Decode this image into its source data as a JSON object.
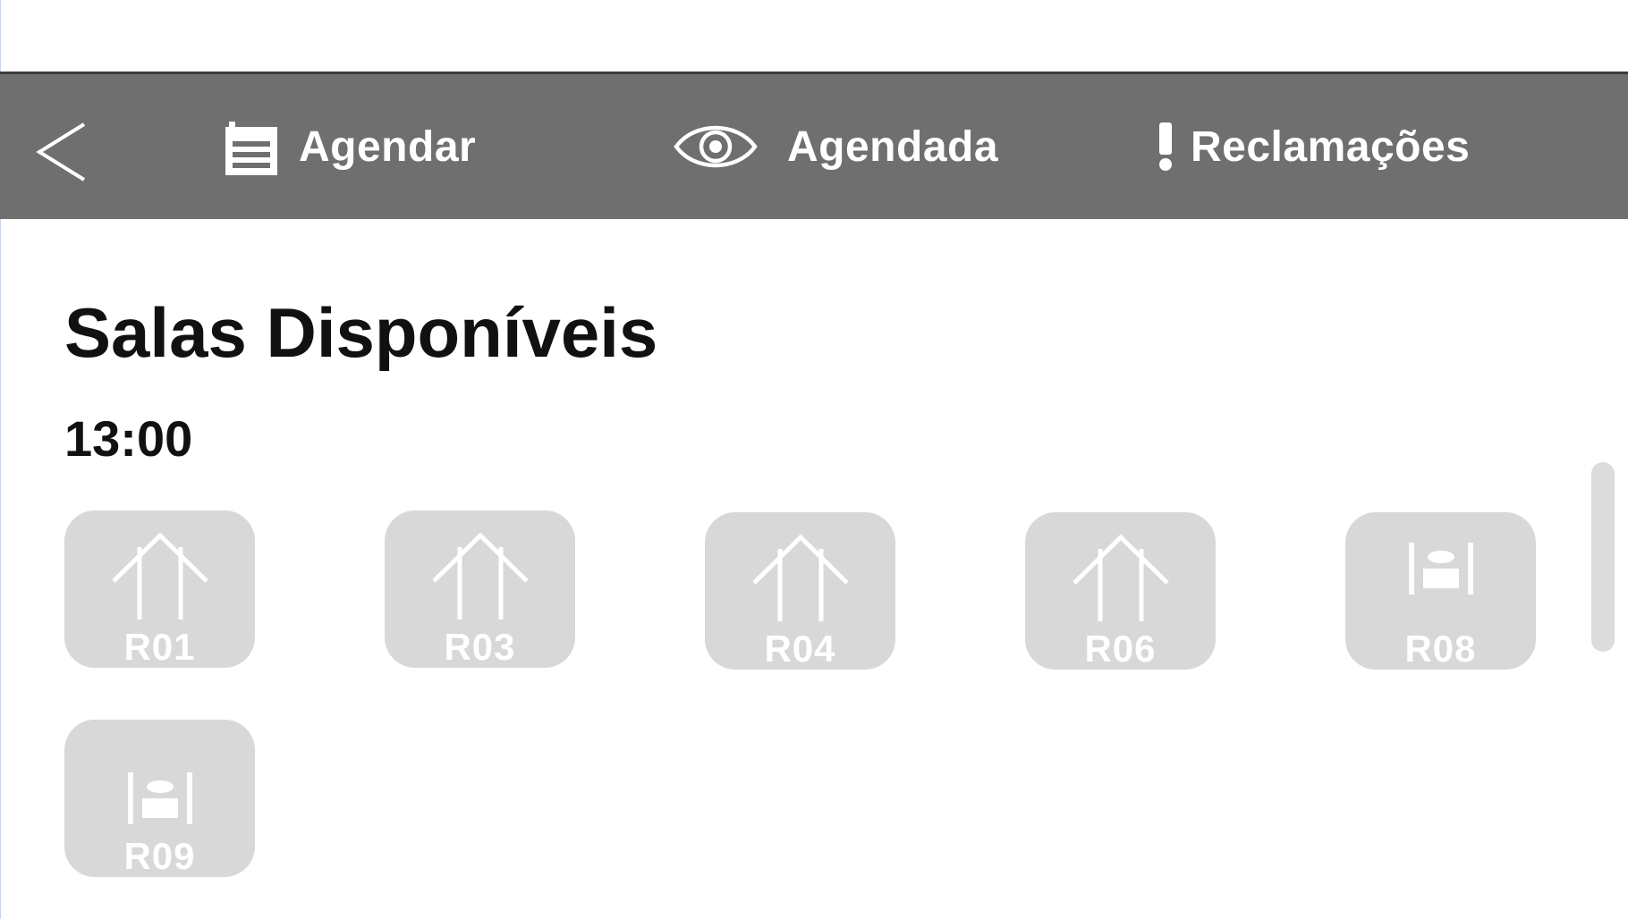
{
  "nav": {
    "back_icon": "chevron-left-icon",
    "items": [
      {
        "label": "Agendar",
        "icon": "calendar-icon"
      },
      {
        "label": "Agendada",
        "icon": "eye-icon"
      },
      {
        "label": "Reclamações",
        "icon": "exclamation-icon"
      }
    ]
  },
  "main": {
    "title": "Salas Disponíveis",
    "time": "13:00",
    "rooms": [
      {
        "label": "R01",
        "icon": "up-arrows-icon"
      },
      {
        "label": "R03",
        "icon": "up-arrows-icon"
      },
      {
        "label": "R04",
        "icon": "up-arrows-icon"
      },
      {
        "label": "R06",
        "icon": "up-arrows-icon"
      },
      {
        "label": "R08",
        "icon": "table-icon"
      },
      {
        "label": "R09",
        "icon": "table-icon"
      }
    ]
  },
  "colors": {
    "navbar": "#706f70",
    "room_tile": "#d8d8d8",
    "text": "#111111",
    "nav_text": "#ffffff"
  }
}
